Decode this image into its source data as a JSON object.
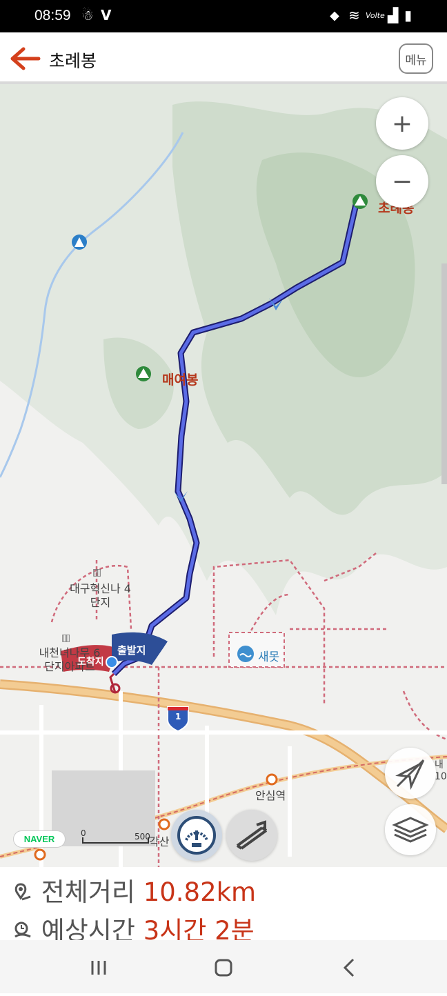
{
  "status": {
    "time": "08:59",
    "lte": "Volte"
  },
  "header": {
    "title": "초례봉",
    "menu_label": "메뉴"
  },
  "map": {
    "peaks": [
      "초례봉",
      "매여봉"
    ],
    "places": [
      "대구혁신나 4단지",
      "내천녀나무 6단지아파트",
      "새못",
      "안심역",
      "각산"
    ],
    "route_flags": {
      "start": "출발지",
      "end": "도착지"
    },
    "highway_number": "1",
    "scale": {
      "zero": "0",
      "distance": "500"
    },
    "naver": "NAVER",
    "partial_right": "내 10"
  },
  "controls": {
    "zoom_in": "+",
    "zoom_out": "−"
  },
  "summary": {
    "distance_label": "전체거리",
    "distance_value": "10.82km",
    "time_label": "예상시간",
    "time_value": "3시간 2분"
  }
}
